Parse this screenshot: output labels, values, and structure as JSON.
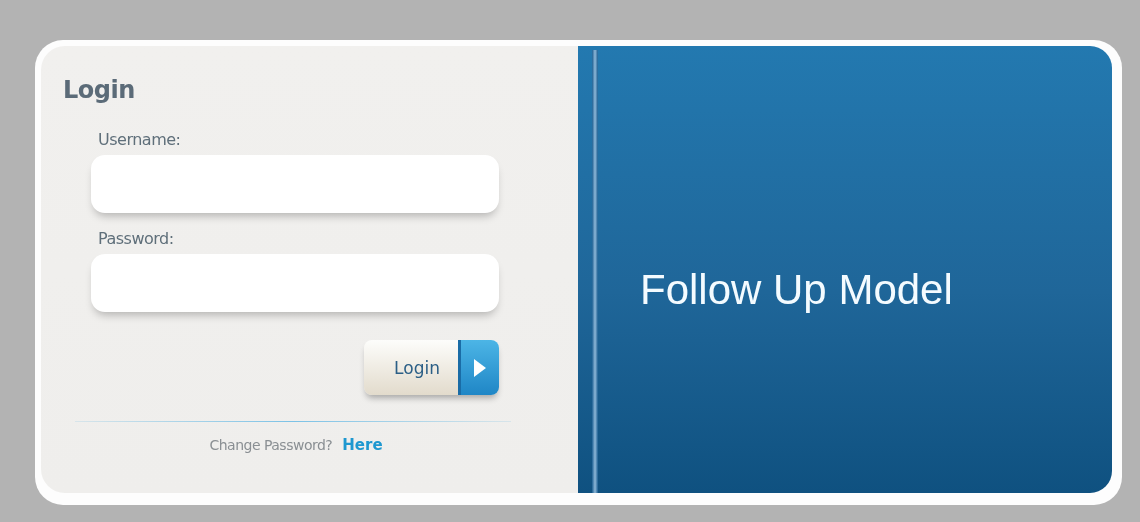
{
  "login_panel": {
    "title": "Login",
    "fields": [
      {
        "label": "Username:"
      },
      {
        "label": "Password:"
      }
    ],
    "button": {
      "label": "Login"
    },
    "footer": {
      "text": "Change Password?",
      "link": "Here"
    }
  },
  "banner": {
    "title": "Follow Up Model"
  }
}
